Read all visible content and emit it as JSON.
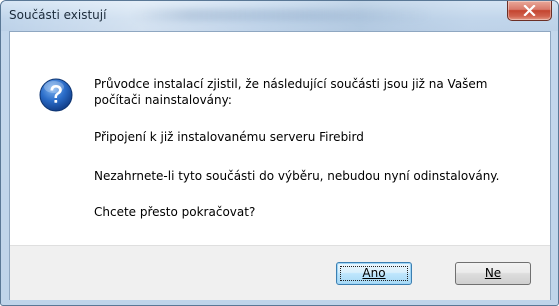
{
  "window": {
    "title": "Součásti existují"
  },
  "dialog": {
    "icon": "question-icon",
    "message_line1": "Průvodce instalací zjistil, že následující součásti jsou již na Vašem",
    "message_line2": "počítači nainstalovány:",
    "component": "Připojení k již instalovanému serveru Firebird",
    "note": "Nezahrnete-li tyto součásti do výběru, nebudou nyní odinstalovány.",
    "question": "Chcete přesto pokračovat?"
  },
  "buttons": {
    "yes_label": "Ano",
    "no_label": "Ne"
  },
  "colors": {
    "title_bar": "#c3d7ec",
    "close_button": "#c4442f",
    "icon_blue": "#1f5fb8",
    "default_button": "#3c7fb1"
  }
}
